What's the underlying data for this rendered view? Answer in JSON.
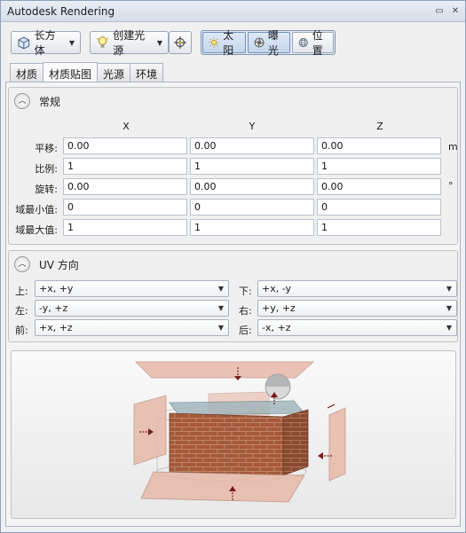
{
  "window": {
    "title": "Autodesk Rendering"
  },
  "toolbar": {
    "box_label": "长方体",
    "light_label": "创建光源",
    "sun_label": "太阳",
    "exposure_label": "曝光",
    "location_label": "位置"
  },
  "tabs": [
    "材质",
    "材质贴图",
    "光源",
    "环境"
  ],
  "general": {
    "header": "常规",
    "col_x": "X",
    "col_y": "Y",
    "col_z": "Z",
    "rows": [
      {
        "label": "平移:",
        "x": "0.00",
        "y": "0.00",
        "z": "0.00",
        "unit": "m"
      },
      {
        "label": "比例:",
        "x": "1",
        "y": "1",
        "z": "1",
        "unit": ""
      },
      {
        "label": "旋转:",
        "x": "0.00",
        "y": "0.00",
        "z": "0.00",
        "unit": "°"
      },
      {
        "label": "域最小值:",
        "x": "0",
        "y": "0",
        "z": "0",
        "unit": ""
      },
      {
        "label": "域最大值:",
        "x": "1",
        "y": "1",
        "z": "1",
        "unit": ""
      }
    ]
  },
  "uv": {
    "header": "UV 方向",
    "top_label": "上:",
    "top_value": "+x, +y",
    "bottom_label": "下:",
    "bottom_value": "+x, -y",
    "left_label": "左:",
    "left_value": "-y, +z",
    "right_label": "右:",
    "right_value": "+y, +z",
    "front_label": "前:",
    "front_value": "+x, +z",
    "back_label": "后:",
    "back_value": "-x, +z"
  },
  "icons": {
    "box": "box-icon",
    "light": "lightbulb-icon",
    "target": "target-icon",
    "sun": "sun-icon",
    "exposure": "aperture-icon",
    "location": "globe-icon"
  }
}
